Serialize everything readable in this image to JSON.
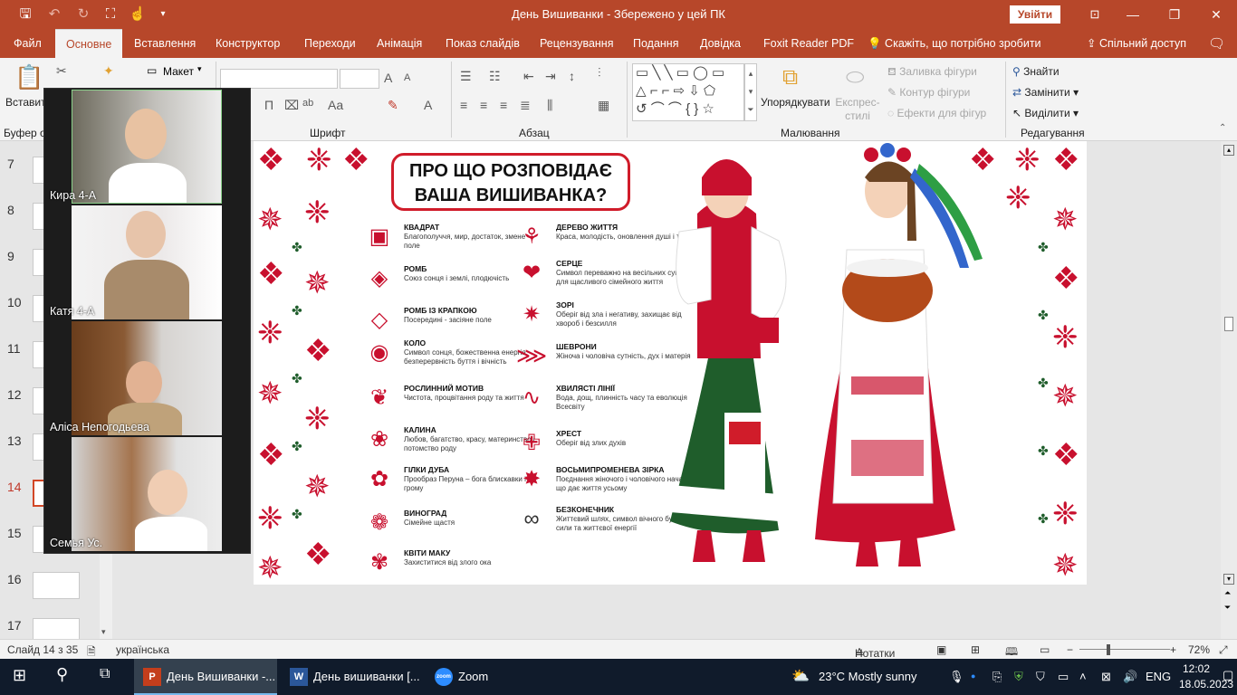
{
  "window": {
    "title": "День Вишиванки  -  Збережено у цей ПК",
    "signin": "Увійти",
    "minimize": "—",
    "restore": "❐",
    "close": "✕"
  },
  "quick_access": [
    "save-icon",
    "undo-icon",
    "redo-icon",
    "slideshow-icon",
    "touch-icon",
    "customize-icon"
  ],
  "tabs": [
    "Файл",
    "Основне",
    "Вставлення",
    "Конструктор",
    "Переходи",
    "Анімація",
    "Показ слайдів",
    "Рецензування",
    "Подання",
    "Довідка",
    "Foxit Reader PDF"
  ],
  "tell_me": "Скажіть, що потрібно зробити",
  "share": "Спільний доступ",
  "ribbon": {
    "paste": "Вставити",
    "clipboard": "Буфер о",
    "layout": "Макет",
    "font_group": "Шрифт",
    "paragraph_group": "Абзац",
    "arrange": "Упорядкувати",
    "quick_styles": "Експрес-стилі",
    "fill": "Заливка фігури",
    "outline": "Контур фігури",
    "effects": "Ефекти для фігур",
    "drawing_group": "Малювання",
    "find": "Знайти",
    "replace": "Замінити",
    "select": "Виділити",
    "editing_group": "Редагування"
  },
  "thumbnails": {
    "numbers": [
      "7",
      "8",
      "9",
      "10",
      "11",
      "12",
      "13",
      "14",
      "15",
      "16",
      "17"
    ],
    "active": "14"
  },
  "zoom": {
    "participants": [
      "Кира 4-А",
      "Катя  4-А",
      "Аліса Непогодьева",
      "Семья Ус."
    ]
  },
  "slide": {
    "title_line1": "ПРО ЩО РОЗПОВІДАЄ",
    "title_line2": "ВАША ВИШИВАНКА?",
    "left_items": [
      {
        "title": "КВАДРАТ",
        "desc": "Благополуччя, мир, достаток, змене поле"
      },
      {
        "title": "РОМБ",
        "desc": "Союз сонця і землі, плодючість"
      },
      {
        "title": "РОМБ ІЗ КРАПКОЮ",
        "desc": "Посередині - засіяне поле"
      },
      {
        "title": "КОЛО",
        "desc": "Символ сонця, божественна енергія, безперервність буття і вічність"
      },
      {
        "title": "РОСЛИННИЙ МОТИВ",
        "desc": "Чистота, процвітання роду та життя"
      },
      {
        "title": "КАЛИНА",
        "desc": "Любов, багатство, красу, материнство і потомство роду"
      },
      {
        "title": "ГІЛКИ ДУБА",
        "desc": "Прообраз Перуна – бога блискавки і грому"
      },
      {
        "title": "ВИНОГРАД",
        "desc": "Сімейне щастя"
      },
      {
        "title": "КВІТИ МАКУ",
        "desc": "Захиститися від злого ока"
      }
    ],
    "right_items": [
      {
        "title": "ДЕРЕВО ЖИТТЯ",
        "desc": "Краса, молодість, оновлення душі і тіла"
      },
      {
        "title": "СЕРЦЕ",
        "desc": "Символ переважно на весільних сукнях для щасливого сімейного життя"
      },
      {
        "title": "ЗОРІ",
        "desc": "Оберіг від зла і негативу, захищає від хвороб і безсилля"
      },
      {
        "title": "ШЕВРОНИ",
        "desc": "Жіноча і чоловіча сутність, дух і матерія"
      },
      {
        "title": "ХВИЛЯСТІ ЛІНІЇ",
        "desc": "Вода, дощ, плинність часу та еволюція Всесвіту"
      },
      {
        "title": "ХРЕСТ",
        "desc": "Оберіг від злих духів"
      },
      {
        "title": "ВОСЬМИПРОМЕНЕВА ЗІРКА",
        "desc": "Поєднання жіночого і чоловічого начал, що дає життя усьому"
      },
      {
        "title": "БЕЗКОНЕЧНИК",
        "desc": "Життєвий шлях, символ вічного буття, сили та життєвої енергії"
      }
    ]
  },
  "statusbar": {
    "slide_info": "Слайд 14 з 35",
    "language": "українська",
    "notes": "Нотатки",
    "zoom": "72%"
  },
  "taskbar": {
    "apps": [
      "День Вишиванки -...",
      "День вишиванки [...",
      "Zoom"
    ],
    "weather": "23°C  Mostly sunny",
    "lang": "ENG",
    "time": "12:02",
    "date": "18.05.2023"
  },
  "colors": {
    "accent": "#b7472a",
    "embroidery_red": "#c8102e",
    "embroidery_green": "#1f5d2b"
  }
}
